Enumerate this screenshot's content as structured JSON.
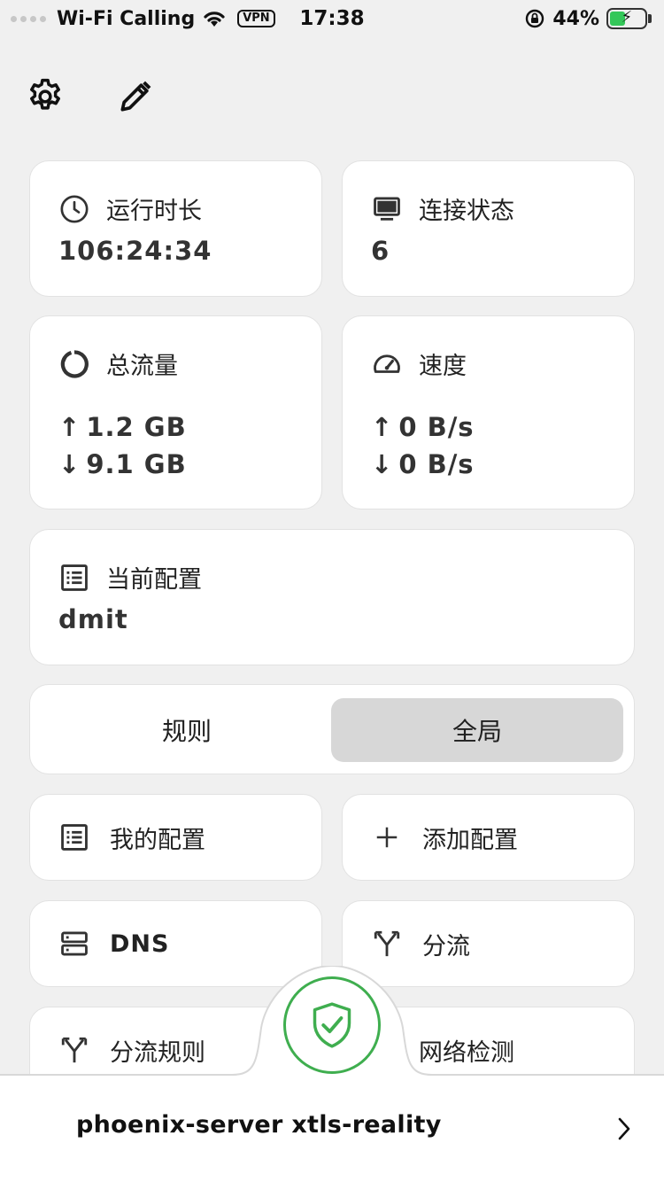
{
  "status_bar": {
    "carrier": "Wi-Fi Calling",
    "vpn": "VPN",
    "time": "17:38",
    "battery_percent": "44%",
    "battery_level": 0.44
  },
  "toolbar": {
    "settings_icon": "gear-icon",
    "edit_icon": "pencil-icon"
  },
  "stats": {
    "uptime": {
      "label": "运行时长",
      "value": "106:24:34",
      "icon": "clock-icon"
    },
    "connections": {
      "label": "连接状态",
      "value": "6",
      "icon": "monitor-icon"
    },
    "traffic": {
      "label": "总流量",
      "up": "1.2 GB",
      "down": "9.1 GB",
      "icon": "ring-icon"
    },
    "speed": {
      "label": "速度",
      "up": "0 B/s",
      "down": "0 B/s",
      "icon": "speedometer-icon"
    },
    "profile": {
      "label": "当前配置",
      "value": "dmit",
      "icon": "list-icon"
    }
  },
  "mode": {
    "options": [
      "规则",
      "全局"
    ],
    "selected": "全局"
  },
  "menu": {
    "my_profiles": "我的配置",
    "add_profile": "添加配置",
    "dns": "DNS",
    "routing": "分流",
    "routing_rules": "分流规则",
    "network_check": "网络检测"
  },
  "bottom": {
    "node": "phoenix-server xtls-reality",
    "accent": "#3fae4f"
  }
}
